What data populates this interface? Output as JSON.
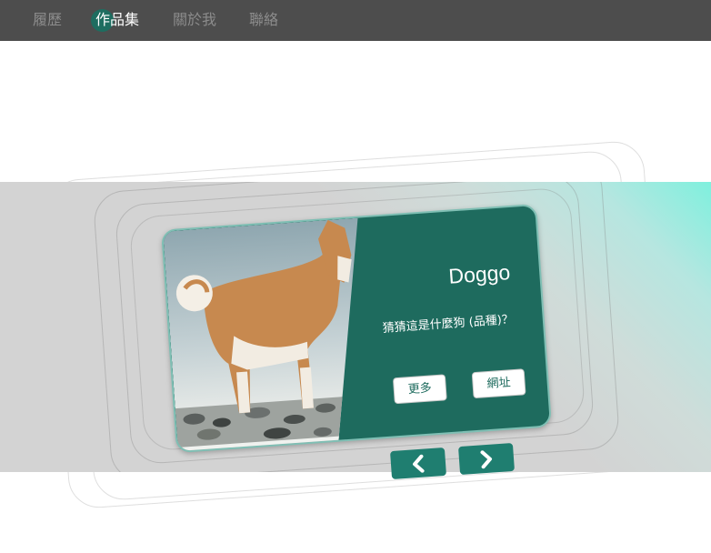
{
  "nav": {
    "items": [
      {
        "label": "履歷"
      },
      {
        "label": "作品集",
        "active": true
      },
      {
        "label": "關於我"
      },
      {
        "label": "聯絡"
      }
    ]
  },
  "card": {
    "title": "Doggo",
    "description": "猜猜這是什麼狗 (品種)？",
    "more_label": "更多",
    "url_label": "網址"
  },
  "controls": {
    "prev_icon": "chevron-left-icon",
    "next_icon": "chevron-right-icon"
  },
  "colors": {
    "nav_bg": "#4d4d4d",
    "accent": "#1e6b5e",
    "button": "#1f7e70",
    "band": "#d3d3d3",
    "glow": "#7ff0de"
  }
}
